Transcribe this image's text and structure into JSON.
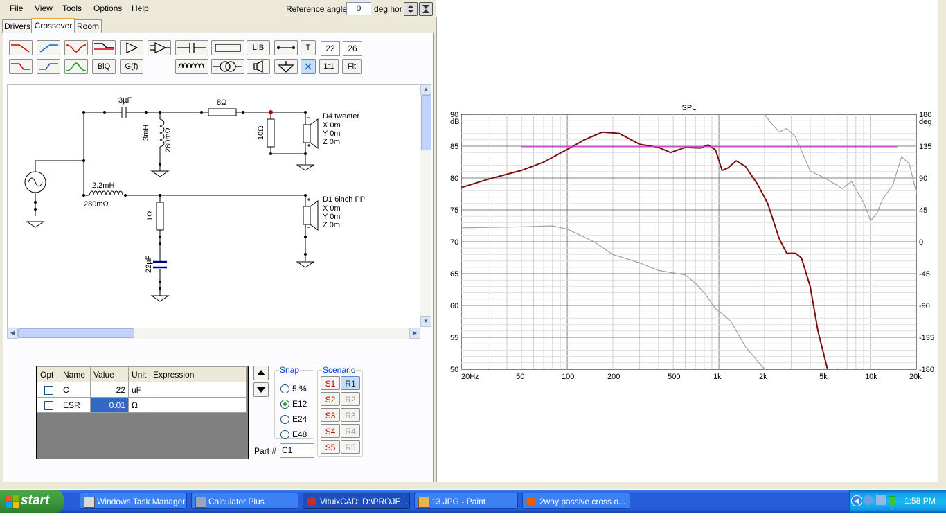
{
  "menu": {
    "items": [
      "File",
      "View",
      "Tools",
      "Options",
      "Help"
    ]
  },
  "reference": {
    "label": "Reference angle",
    "value": "0",
    "unit": "deg hor"
  },
  "tabs": [
    "Drivers",
    "Crossover",
    "Room"
  ],
  "toolbar": {
    "lib": "LIB",
    "t": "T",
    "biq": "BiQ",
    "gf": "G(f)",
    "one_to_one": "1:1",
    "fit": "Fit",
    "num1": "22",
    "num2": "26"
  },
  "schematic": {
    "c_top": "3µF",
    "l_tweeter": "3mH",
    "l_tweeter_esr": "280mΩ",
    "r_series": "8Ω",
    "r_parallel": "10Ω",
    "tweeter_name": "D4 tweeter",
    "tweeter_x": "X 0m",
    "tweeter_y": "Y 0m",
    "tweeter_z": "Z 0m",
    "l_woofer": "2.2mH",
    "l_woofer_esr": "280mΩ",
    "r_woofer": "1Ω",
    "c_woofer": "22µF",
    "woofer_name": "D1 6inch PP",
    "woofer_x": "X 0m",
    "woofer_y": "Y 0m",
    "woofer_z": "Z 0m"
  },
  "parts_table": {
    "headers": [
      "Opt",
      "Name",
      "Value",
      "Unit",
      "Expression"
    ],
    "rows": [
      {
        "name": "C",
        "value": "22",
        "unit": "uF",
        "expr": ""
      },
      {
        "name": "ESR",
        "value": "0.01",
        "unit": "Ω",
        "expr": ""
      }
    ]
  },
  "snap": {
    "title": "Snap",
    "options": [
      "5 %",
      "E12",
      "E24",
      "E48"
    ],
    "selected": "E12"
  },
  "scenario": {
    "title": "Scenario",
    "s": [
      "S1",
      "S2",
      "S3",
      "S4",
      "S5"
    ],
    "r": [
      "R1",
      "R2",
      "R3",
      "R4",
      "R5"
    ]
  },
  "part": {
    "label": "Part #",
    "value": "C1"
  },
  "chart_data": {
    "type": "line",
    "title": "SPL",
    "ylabel_left": "dB",
    "ylabel_right": "deg",
    "xscale": "log",
    "xlim": [
      20,
      20000
    ],
    "ylim": [
      50,
      90
    ],
    "ylim_right": [
      -180,
      180
    ],
    "x_ticks": [
      20,
      50,
      100,
      200,
      500,
      1000,
      2000,
      5000,
      10000,
      20000
    ],
    "x_tick_labels": [
      "20Hz",
      "50",
      "100",
      "200",
      "500",
      "1k",
      "2k",
      "5k",
      "10k",
      "20k"
    ],
    "y_ticks": [
      50,
      55,
      60,
      65,
      70,
      75,
      80,
      85,
      90
    ],
    "y_right_ticks": [
      -180,
      -135,
      -90,
      -45,
      0,
      45,
      90,
      135,
      180
    ],
    "grid": true,
    "colors": {
      "spl": "#7a0f0f",
      "target": "#e040e0",
      "phase": "#a0a0a0",
      "lower": "#a0a0a0"
    },
    "series": [
      {
        "axis": "left",
        "color": "#7a0f0f",
        "points": [
          [
            20,
            78.5
          ],
          [
            30,
            79.8
          ],
          [
            50,
            81.2
          ],
          [
            70,
            82.5
          ],
          [
            100,
            84.5
          ],
          [
            130,
            86.0
          ],
          [
            170,
            87.2
          ],
          [
            220,
            87.0
          ],
          [
            300,
            85.3
          ],
          [
            400,
            84.8
          ],
          [
            480,
            84.0
          ],
          [
            600,
            84.8
          ],
          [
            750,
            84.7
          ],
          [
            850,
            85.2
          ],
          [
            950,
            84.4
          ],
          [
            1050,
            81.2
          ],
          [
            1150,
            81.6
          ],
          [
            1300,
            82.7
          ],
          [
            1500,
            81.8
          ],
          [
            1800,
            79.0
          ],
          [
            2100,
            76.0
          ],
          [
            2500,
            70.5
          ],
          [
            2800,
            68.2
          ],
          [
            3200,
            68.2
          ],
          [
            3500,
            67.5
          ],
          [
            4000,
            63.0
          ],
          [
            4500,
            56.0
          ],
          [
            5200,
            50.0
          ]
        ]
      },
      {
        "axis": "left",
        "color": "#e040e0",
        "points": [
          [
            50,
            84.9
          ],
          [
            15000,
            84.9
          ]
        ]
      },
      {
        "axis": "left",
        "color": "#a0a0a0",
        "points": [
          [
            20,
            72.2
          ],
          [
            40,
            72.3
          ],
          [
            60,
            72.4
          ],
          [
            80,
            72.5
          ],
          [
            100,
            72.0
          ],
          [
            150,
            70.0
          ],
          [
            200,
            68.0
          ],
          [
            300,
            66.7
          ],
          [
            400,
            65.5
          ],
          [
            600,
            64.8
          ],
          [
            700,
            63.5
          ],
          [
            800,
            62.0
          ],
          [
            950,
            59.5
          ],
          [
            1050,
            58.7
          ],
          [
            1200,
            57.5
          ],
          [
            1500,
            53.5
          ],
          [
            2000,
            50.0
          ]
        ]
      },
      {
        "axis": "right",
        "color": "#a0a0a0",
        "points": [
          [
            2000,
            180
          ],
          [
            2200,
            168
          ],
          [
            2500,
            155
          ],
          [
            2800,
            160
          ],
          [
            3200,
            148
          ],
          [
            4000,
            100
          ],
          [
            5000,
            90
          ],
          [
            6500,
            75
          ],
          [
            7500,
            85
          ],
          [
            9000,
            55
          ],
          [
            10000,
            30
          ],
          [
            11000,
            40
          ],
          [
            12000,
            60
          ],
          [
            14000,
            80
          ],
          [
            16000,
            120
          ],
          [
            18000,
            110
          ],
          [
            20000,
            70
          ]
        ]
      }
    ]
  },
  "taskbar": {
    "start": "start",
    "buttons": [
      "Windows Task Manager",
      "Calculator Plus",
      "VituixCAD: D:\\PROJE...",
      "13.JPG - Paint",
      "2way passive cross o..."
    ],
    "time": "1:58 PM"
  }
}
